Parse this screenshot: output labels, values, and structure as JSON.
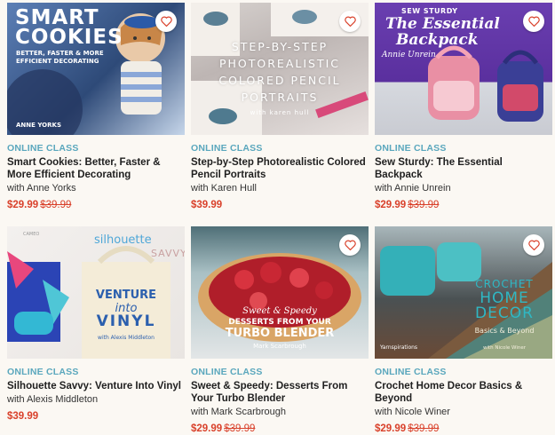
{
  "cards": [
    {
      "type_label": "ONLINE CLASS",
      "title": "Smart Cookies: Better, Faster & More Efficient Decorating",
      "instructor": "with Anne Yorks",
      "price": "$29.99",
      "original_price": "$39.99",
      "thumb_text": {
        "line1": "SMART",
        "line2": "COOKIES",
        "sub1": "BETTER, FASTER & MORE",
        "sub2": "EFFICIENT DECORATING",
        "credit": "ANNE YORKS"
      }
    },
    {
      "type_label": "ONLINE CLASS",
      "title": "Step-by-Step Photorealistic Colored Pencil Portraits",
      "instructor": "with Karen Hull",
      "price": "$39.99",
      "original_price": "",
      "thumb_text": {
        "l1": "STEP-BY-STEP",
        "l2": "PHOTOREALISTIC",
        "l3": "COLORED PENCIL",
        "l4": "PORTRAITS",
        "credit": "with karen hull"
      }
    },
    {
      "type_label": "ONLINE CLASS",
      "title": "Sew Sturdy: The Essential Backpack",
      "instructor": "with Annie Unrein",
      "price": "$29.99",
      "original_price": "$39.99",
      "thumb_text": {
        "l1": "SEW STURDY",
        "l2": "The Essential",
        "l3": "Backpack",
        "credit": "Annie Unrein"
      }
    },
    {
      "type_label": "ONLINE CLASS",
      "title": "Silhouette Savvy: Venture Into Vinyl",
      "instructor": "with Alexis Middleton",
      "price": "$39.99",
      "original_price": "",
      "thumb_text": {
        "brand": "silhouette",
        "savvy": "SAVVY",
        "l1": "VENTURE",
        "l2": "into",
        "l3": "VINYL",
        "credit": "with Alexis Middleton",
        "cameo": "CAMEO"
      }
    },
    {
      "type_label": "ONLINE CLASS",
      "title": "Sweet & Speedy: Desserts From Your Turbo Blender",
      "instructor": "with Mark Scarbrough",
      "price": "$29.99",
      "original_price": "$39.99",
      "thumb_text": {
        "l1": "Sweet & Speedy",
        "l2": "DESSERTS FROM YOUR",
        "l3": "TURBO BLENDER",
        "credit": "Mark Scarbrough"
      }
    },
    {
      "type_label": "ONLINE CLASS",
      "title": "Crochet Home Decor Basics & Beyond",
      "instructor": "with Nicole Winer",
      "price": "$29.99",
      "original_price": "$39.99",
      "thumb_text": {
        "l1": "CROCHET",
        "l2": "HOME",
        "l3": "DECOR",
        "l4": "Basics & Beyond",
        "credit": "with Nicole Winer",
        "brand": "Yarnspirations"
      }
    }
  ],
  "colors": {
    "type_label": "#5aa7bd",
    "sale": "#d9412b",
    "heart": "#d9412b",
    "background": "#fbf8f3"
  },
  "icons": {
    "favorite": "heart-icon"
  }
}
